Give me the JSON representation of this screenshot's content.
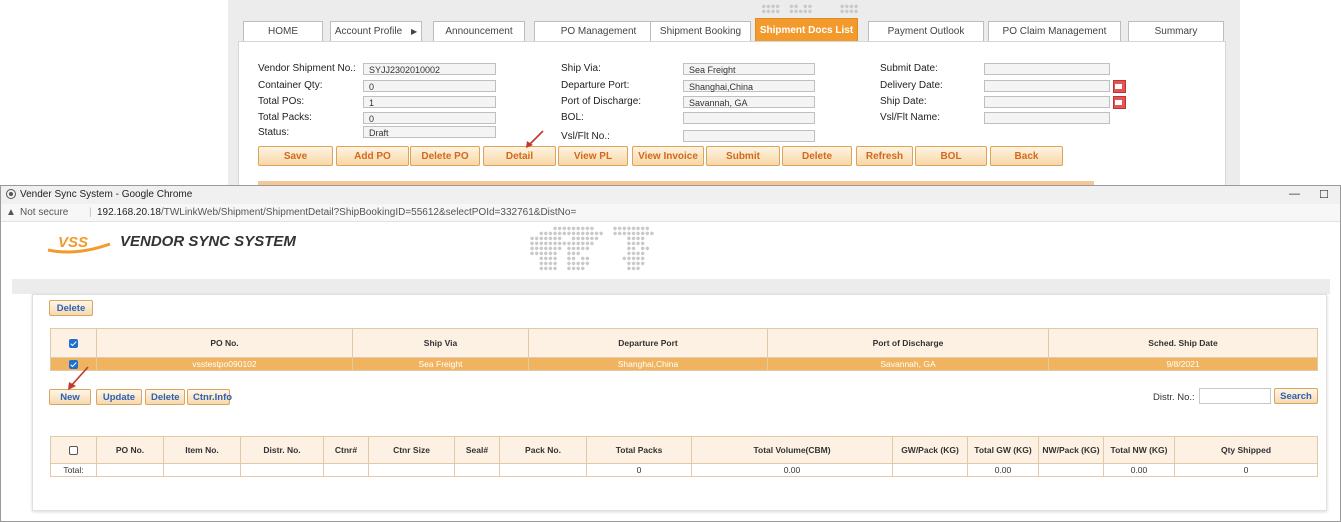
{
  "background_app": {
    "tabs": [
      {
        "label": "HOME",
        "active": false
      },
      {
        "label": "Account Profile",
        "active": false
      },
      {
        "label": "Announcement",
        "active": false
      },
      {
        "label": "PO Management",
        "active": false
      },
      {
        "label": "Shipment Booking",
        "active": false
      },
      {
        "label": "Shipment Docs List",
        "active": true
      },
      {
        "label": "Payment Outlook",
        "active": false
      },
      {
        "label": "PO Claim Management",
        "active": false
      },
      {
        "label": "Summary",
        "active": false
      }
    ],
    "fields": {
      "vendor_shipment_no": {
        "label": "Vendor Shipment No.:",
        "value": "SYJJ2302010002"
      },
      "container_qty": {
        "label": "Container Qty:",
        "value": "0"
      },
      "total_pos": {
        "label": "Total POs:",
        "value": "1"
      },
      "total_packs": {
        "label": "Total Packs:",
        "value": "0"
      },
      "status": {
        "label": "Status:",
        "value": "Draft"
      },
      "ship_via": {
        "label": "Ship Via:",
        "value": "Sea Freight"
      },
      "departure_port": {
        "label": "Departure Port:",
        "value": "Shanghai,China"
      },
      "port_of_discharge": {
        "label": "Port of Discharge:",
        "value": "Savannah, GA"
      },
      "bol": {
        "label": "BOL:",
        "value": ""
      },
      "vsl_flt_no": {
        "label": "Vsl/Flt No.:",
        "value": ""
      },
      "submit_date": {
        "label": "Submit Date:",
        "value": ""
      },
      "delivery_date": {
        "label": "Delivery Date:",
        "value": ""
      },
      "ship_date": {
        "label": "Ship Date:",
        "value": ""
      },
      "vsl_flt_name": {
        "label": "Vsl/Flt Name:",
        "value": ""
      }
    },
    "buttons": [
      "Save",
      "Add PO",
      "Delete PO",
      "Detail",
      "View PL",
      "View Invoice",
      "Submit",
      "Delete",
      "Refresh",
      "BOL",
      "Back"
    ]
  },
  "window": {
    "title": "Vender Sync System - Google Chrome",
    "not_secure": "Not secure",
    "url_host": "192.168.20.18",
    "url_path": "/TWLinkWeb/Shipment/ShipmentDetail?ShipBookingID=55612&selectPOId=332761&DistNo=",
    "minimize": "—",
    "maximize": "☐"
  },
  "page": {
    "logo_text": "VSS",
    "app_name": "VENDOR SYNC SYSTEM",
    "delete_button": "Delete",
    "po_table": {
      "columns": [
        "PO No.",
        "Ship Via",
        "Departure Port",
        "Port of Discharge",
        "Sched. Ship Date"
      ],
      "rows": [
        {
          "checked": true,
          "cells": [
            "vsstestpo090102",
            "Sea Freight",
            "Shanghai,China",
            "Savannah, GA",
            "9/8/2021"
          ]
        }
      ],
      "header_checked": true
    },
    "actions": {
      "new": "New",
      "update": "Update",
      "delete": "Delete",
      "ctnr_info": "Ctnr.Info"
    },
    "distr_label": "Distr. No.:",
    "distr_value": "",
    "search_button": "Search",
    "detail_table": {
      "columns": [
        "PO No.",
        "Item No.",
        "Distr. No.",
        "Ctnr#",
        "Ctnr Size",
        "Seal#",
        "Pack No.",
        "Total Packs",
        "Total Volume(CBM)",
        "GW/Pack (KG)",
        "Total GW (KG)",
        "NW/Pack (KG)",
        "Total NW (KG)",
        "Qty Shipped"
      ],
      "total_row": [
        "Total:",
        "",
        "",
        "",
        "",
        "",
        "",
        "",
        "0",
        "0.00",
        "",
        "0.00",
        "",
        "0.00",
        "0"
      ]
    }
  }
}
